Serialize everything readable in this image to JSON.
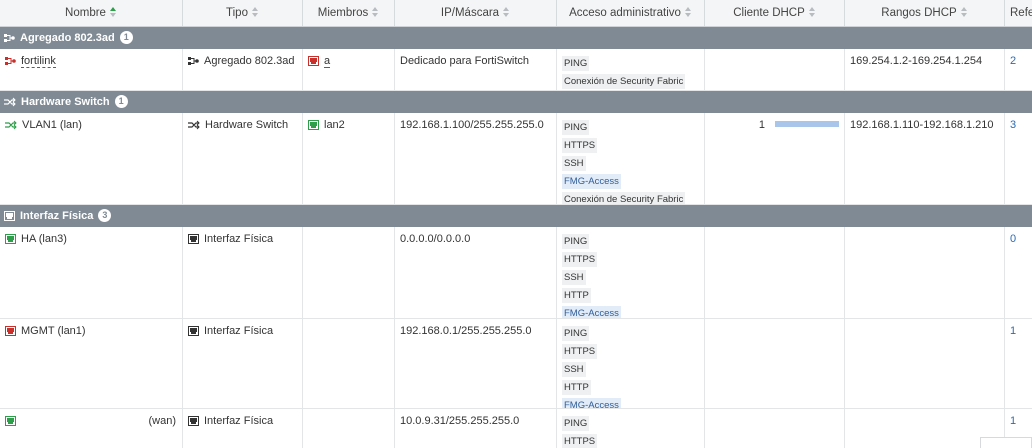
{
  "columns": [
    "Nombre",
    "Tipo",
    "Miembros",
    "IP/Máscara",
    "Acceso administrativo",
    "Cliente DHCP",
    "Rangos DHCP",
    "Refe"
  ],
  "groups": [
    {
      "label": "Agregado 802.3ad",
      "count": "1"
    },
    {
      "label": "Hardware Switch",
      "count": "1"
    },
    {
      "label": "Interfaz Física",
      "count": "3"
    }
  ],
  "rows": {
    "fortilink": {
      "name": "fortilink",
      "type": "Agregado 802.3ad",
      "member": "a",
      "ip": "Dedicado para FortiSwitch",
      "access": [
        "PING",
        "Conexión de Security Fabric"
      ],
      "dhcp_range": "169.254.1.2-169.254.1.254",
      "ref": "2"
    },
    "vlan1": {
      "name": "VLAN1 (lan)",
      "type": "Hardware Switch",
      "member": "lan2",
      "ip": "192.168.1.100/255.255.255.0",
      "access": [
        "PING",
        "HTTPS",
        "SSH",
        "FMG-Access",
        "Conexión de Security Fabric"
      ],
      "dhcp_clients": "1",
      "dhcp_client_fraction": 1.0,
      "dhcp_range": "192.168.1.110-192.168.1.210",
      "ref": "3"
    },
    "ha": {
      "name": "HA (lan3)",
      "type": "Interfaz Física",
      "ip": "0.0.0.0/0.0.0.0",
      "access": [
        "PING",
        "HTTPS",
        "SSH",
        "HTTP",
        "FMG-Access"
      ],
      "ref": "0"
    },
    "mgmt": {
      "name": "MGMT (lan1)",
      "type": "Interfaz Física",
      "ip": "192.168.0.1/255.255.255.0",
      "access": [
        "PING",
        "HTTPS",
        "SSH",
        "HTTP",
        "FMG-Access"
      ],
      "ref": "1"
    },
    "wan": {
      "name": "(wan)",
      "type": "Interfaz Física",
      "ip": "10.0.9.31/255.255.255.0",
      "access": [
        "PING",
        "HTTPS"
      ],
      "ref": "1"
    }
  },
  "colors": {
    "group_bg": "#7f8a94",
    "port_green": "#2e9e4a",
    "port_red": "#c9302c",
    "link": "#2a6bb3"
  }
}
